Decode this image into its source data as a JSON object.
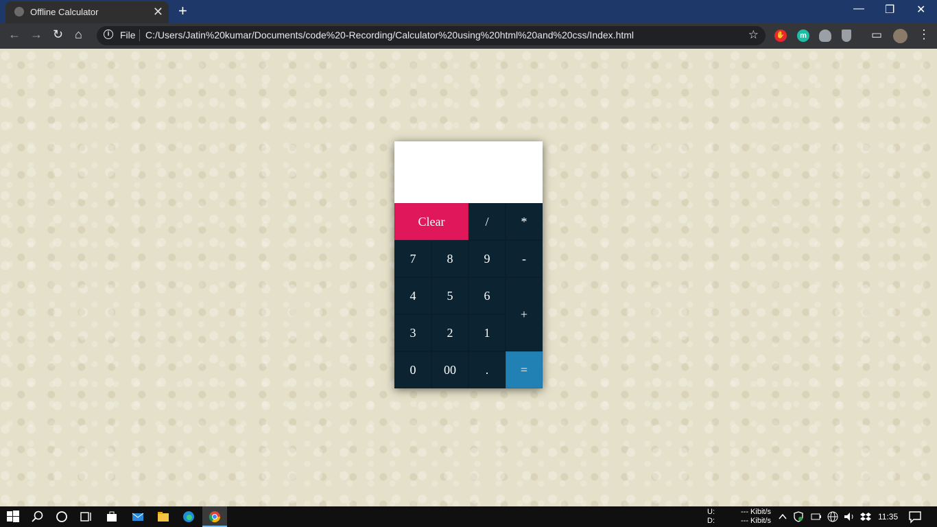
{
  "browser": {
    "tab_title": "Offline Calculator",
    "tab_close": "✕",
    "new_tab": "+",
    "window_controls": {
      "minimize": "—",
      "restore": "❐",
      "close": "✕"
    },
    "nav": {
      "back": "←",
      "forward": "→",
      "reload": "↻",
      "home": "⌂"
    },
    "omnibox": {
      "info": "i",
      "scheme_label": "File",
      "url": "C:/Users/Jatin%20kumar/Documents/code%20-Recording/Calculator%20using%20html%20and%20css/Index.html",
      "star": "☆"
    },
    "extensions": [
      {
        "name": "stop-hand-extension-icon",
        "color": "#e8262e",
        "glyph": "✋"
      },
      {
        "name": "m-extension-icon",
        "color": "#1ebea5",
        "glyph": "m"
      },
      {
        "name": "cloud-extension-icon",
        "color": "#9aa0a6",
        "glyph": ""
      },
      {
        "name": "shield-extension-icon",
        "color": "#9aa0a6",
        "glyph": ""
      }
    ],
    "cast": "▭",
    "menu": "⋮"
  },
  "calculator": {
    "display_value": "",
    "keys": {
      "clear": "Clear",
      "divide": "/",
      "multiply": "*",
      "seven": "7",
      "eight": "8",
      "nine": "9",
      "minus": "-",
      "four": "4",
      "five": "5",
      "six": "6",
      "plus": "+",
      "three": "3",
      "two": "2",
      "one": "1",
      "zero": "0",
      "double_zero": "00",
      "decimal": ".",
      "equals": "="
    },
    "colors": {
      "key_bg": "#0c2431",
      "clear_bg": "#e0175a",
      "equals_bg": "#2181b5",
      "display_bg": "#ffffff"
    }
  },
  "taskbar": {
    "network_up_label": "U:",
    "network_down_label": "D:",
    "network_up_value": "--- Kibit/s",
    "network_down_value": "--- Kibit/s",
    "clock": "11:35"
  }
}
